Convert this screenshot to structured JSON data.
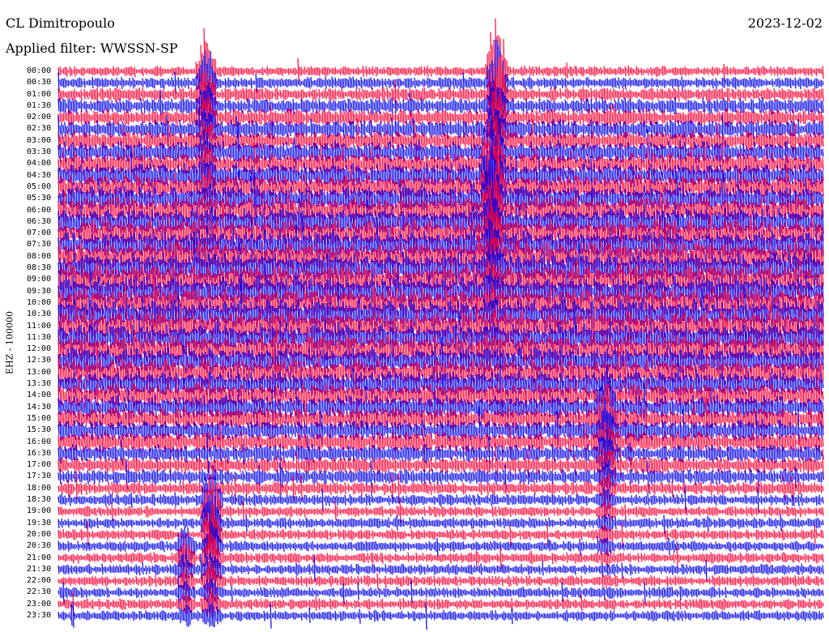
{
  "header": {
    "station": "CL Dimitropoulo",
    "filter": "Applied filter: WWSSN-SP",
    "date": "2023-12-02"
  },
  "chart_data": {
    "type": "line",
    "title": "CL Dimitropoulo",
    "subtitle": "Applied filter: WWSSN-SP",
    "date": "2023-12-02",
    "ylabel": "EHZ - 100000",
    "xlabel": "",
    "y_tick_labels": [
      "00:00",
      "00:30",
      "01:00",
      "01:30",
      "02:00",
      "02:30",
      "03:00",
      "03:30",
      "04:00",
      "04:30",
      "05:00",
      "05:30",
      "06:00",
      "06:30",
      "07:00",
      "07:30",
      "08:00",
      "08:30",
      "09:00",
      "09:30",
      "10:00",
      "10:30",
      "11:00",
      "11:30",
      "12:00",
      "12:30",
      "13:00",
      "13:30",
      "14:00",
      "14:30",
      "15:00",
      "15:30",
      "16:00",
      "16:30",
      "17:00",
      "17:30",
      "18:00",
      "18:30",
      "19:00",
      "19:30",
      "20:00",
      "20:30",
      "21:00",
      "21:30",
      "22:00",
      "22:30",
      "23:00",
      "23:30"
    ],
    "x_range_minutes": [
      0,
      30
    ],
    "series_colors": [
      "#ff0033",
      "#0000ee"
    ],
    "grid": false,
    "legend": "none",
    "events": [
      {
        "line_time": "00:00",
        "minute": 5.8,
        "scale": 3.0
      },
      {
        "line_time": "00:00",
        "minute": 17.2,
        "scale": 4.5
      },
      {
        "line_time": "03:30",
        "minute": 17.0,
        "scale": 5.0
      },
      {
        "line_time": "18:30",
        "minute": 6.0,
        "scale": 4.0
      },
      {
        "line_time": "14:30",
        "minute": 21.5,
        "scale": 2.5
      },
      {
        "line_time": "20:30",
        "minute": 5.0,
        "scale": 1.5
      }
    ]
  }
}
